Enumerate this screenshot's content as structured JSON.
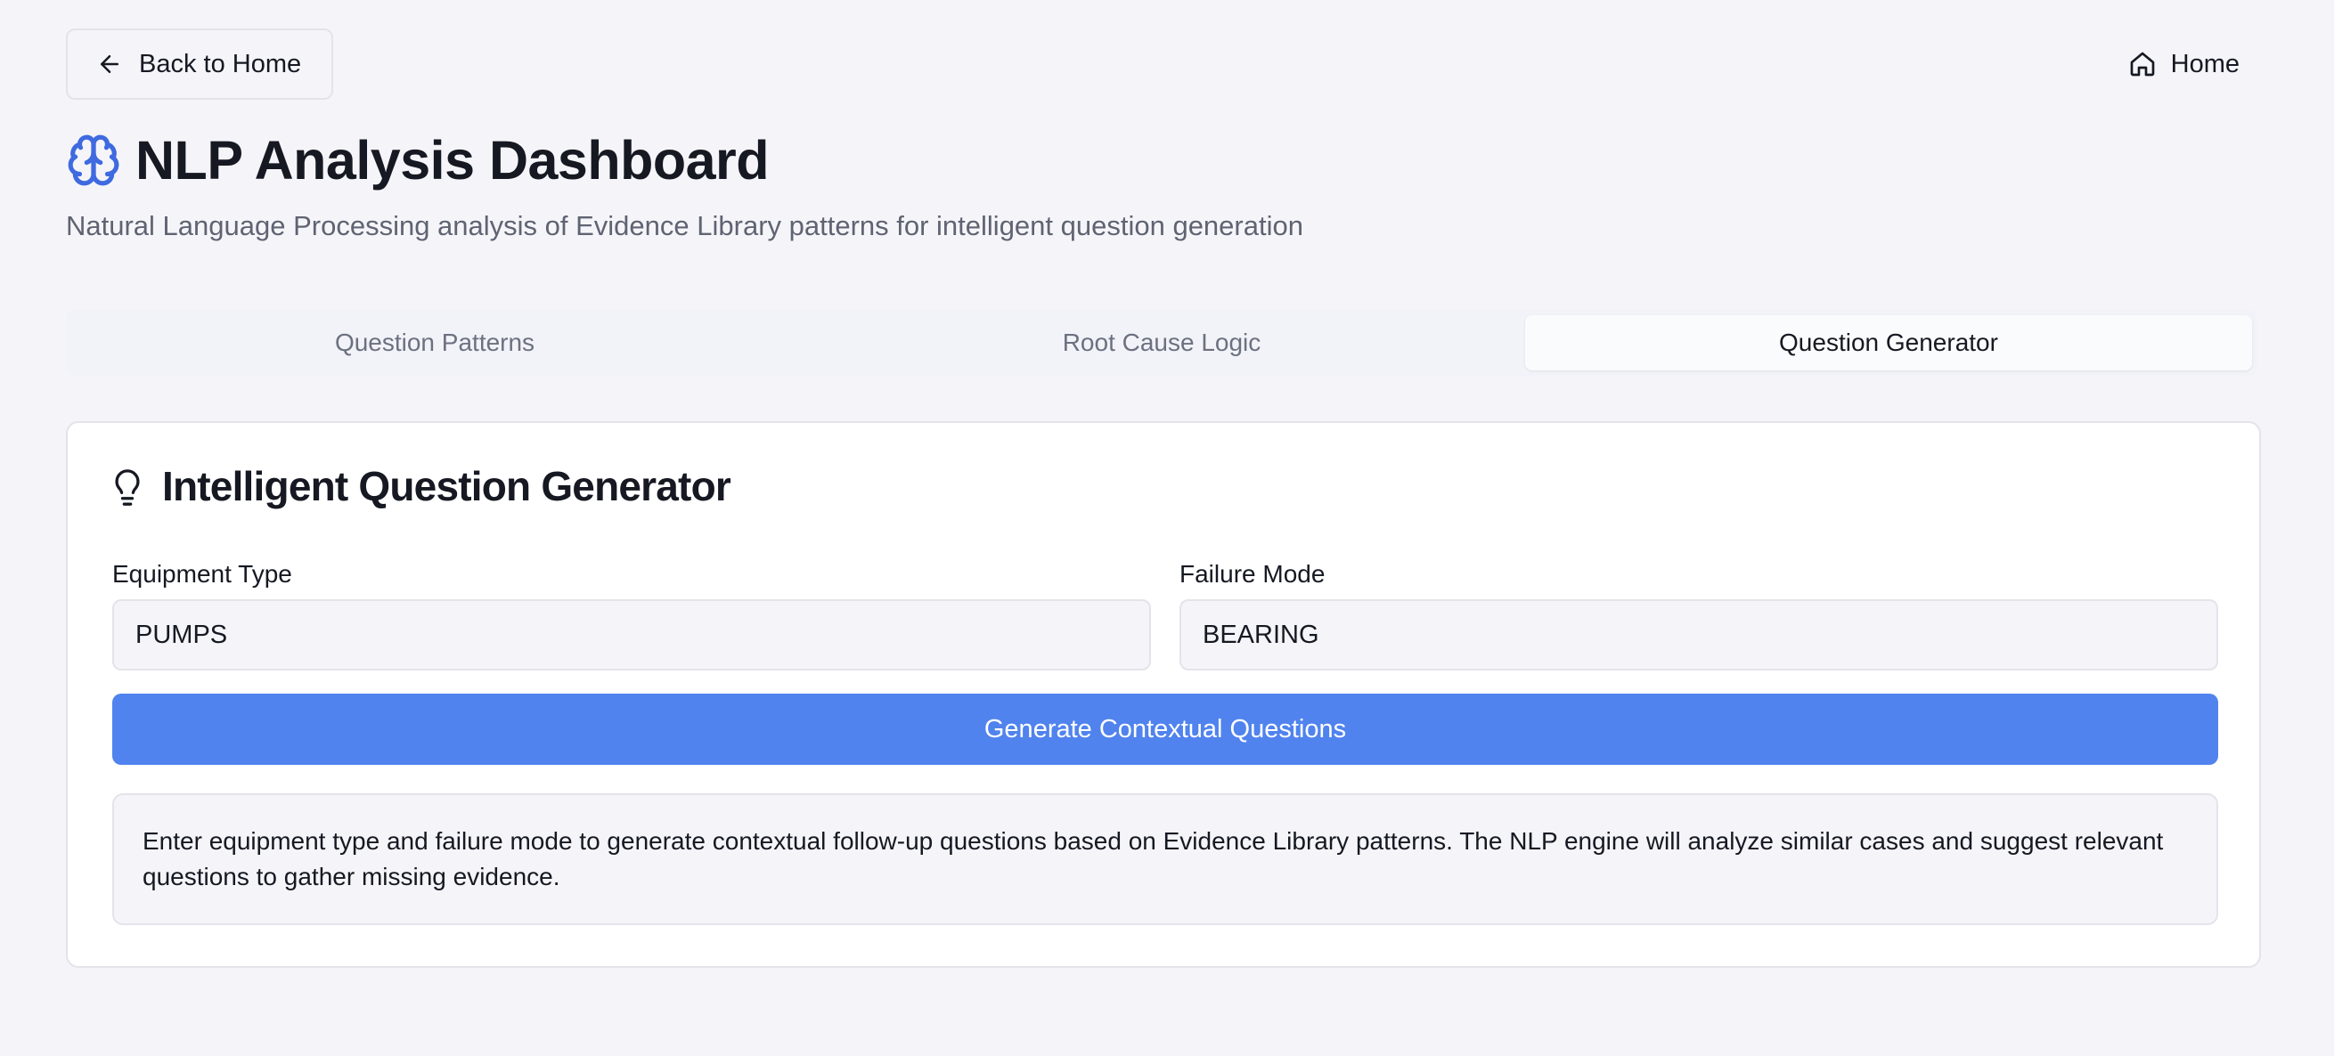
{
  "header": {
    "back_label": "Back to Home",
    "home_label": "Home"
  },
  "page": {
    "title": "NLP Analysis Dashboard",
    "subtitle": "Natural Language Processing analysis of Evidence Library patterns for intelligent question generation"
  },
  "tabs": [
    {
      "label": "Question Patterns",
      "active": false
    },
    {
      "label": "Root Cause Logic",
      "active": false
    },
    {
      "label": "Question Generator",
      "active": true
    }
  ],
  "generator": {
    "title": "Intelligent Question Generator",
    "equipment_label": "Equipment Type",
    "equipment_value": "PUMPS",
    "failure_label": "Failure Mode",
    "failure_value": "BEARING",
    "generate_label": "Generate Contextual Questions",
    "info_text": "Enter equipment type and failure mode to generate contextual follow-up questions based on Evidence Library patterns. The NLP engine will analyze similar cases and suggest relevant questions to gather missing evidence."
  },
  "icons": {
    "back": "arrow-left-icon",
    "home": "home-icon",
    "title": "brain-icon",
    "card": "lightbulb-icon"
  },
  "colors": {
    "accent": "#5083ee",
    "brain_icon": "#3f6ae0",
    "background": "#f5f5f9"
  }
}
